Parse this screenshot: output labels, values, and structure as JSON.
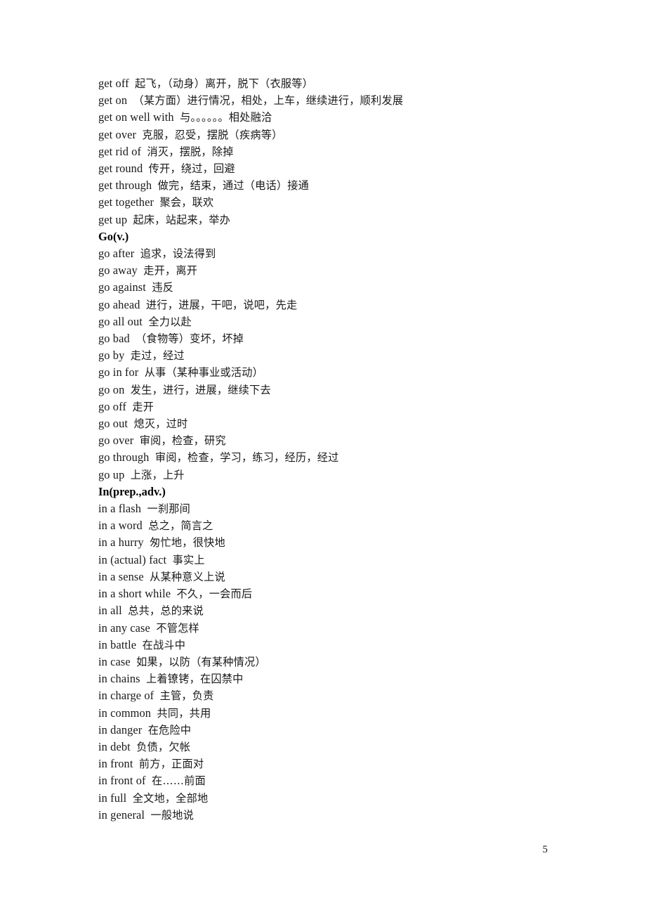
{
  "document": {
    "page_number": "5",
    "lines": [
      {
        "type": "entry",
        "term": "get off",
        "gloss": "起飞，（动身）离开，脱下（衣服等）"
      },
      {
        "type": "entry",
        "term": "get on",
        "gloss": "（某方面）进行情况，相处，上车，继续进行，顺利发展"
      },
      {
        "type": "entry",
        "term": "get on well with",
        "gloss": "与。。。。。。相处融洽"
      },
      {
        "type": "entry",
        "term": "get over",
        "gloss": "克服，忍受，摆脱（疾病等）"
      },
      {
        "type": "entry",
        "term": "get rid of",
        "gloss": "消灭，摆脱，除掉"
      },
      {
        "type": "entry",
        "term": "get round",
        "gloss": "传开，绕过，回避"
      },
      {
        "type": "entry",
        "term": "get through",
        "gloss": "做完，结束，通过（电话）接通"
      },
      {
        "type": "entry",
        "term": "get together",
        "gloss": "聚会，联欢"
      },
      {
        "type": "entry",
        "term": "get up",
        "gloss": "起床，站起来，举办"
      },
      {
        "type": "heading",
        "text": "Go(v.)"
      },
      {
        "type": "entry",
        "term": "go after",
        "gloss": "追求，设法得到"
      },
      {
        "type": "entry",
        "term": "go away",
        "gloss": "走开，离开"
      },
      {
        "type": "entry",
        "term": "go against",
        "gloss": "违反"
      },
      {
        "type": "entry",
        "term": "go ahead",
        "gloss": "进行，进展，干吧，说吧，先走"
      },
      {
        "type": "entry",
        "term": "go all out",
        "gloss": "全力以赴"
      },
      {
        "type": "entry",
        "term": "go bad",
        "gloss": "（食物等）变坏，坏掉"
      },
      {
        "type": "entry",
        "term": "go by",
        "gloss": "走过，经过"
      },
      {
        "type": "entry",
        "term": "go in for",
        "gloss": "从事（某种事业或活动）"
      },
      {
        "type": "entry",
        "term": "go on",
        "gloss": "发生，进行，进展，继续下去"
      },
      {
        "type": "entry",
        "term": "go off",
        "gloss": "走开"
      },
      {
        "type": "entry",
        "term": "go out",
        "gloss": "熄灭，过时"
      },
      {
        "type": "entry",
        "term": "go over",
        "gloss": "审阅，检查，研究"
      },
      {
        "type": "entry",
        "term": "go through",
        "gloss": "审阅，检查，学习，练习，经历，经过"
      },
      {
        "type": "entry",
        "term": "go up",
        "gloss": "上涨，上升"
      },
      {
        "type": "heading",
        "text": "In(prep.,adv.)"
      },
      {
        "type": "entry",
        "term": "in a flash",
        "gloss": "一刹那间"
      },
      {
        "type": "entry",
        "term": "in a word",
        "gloss": "总之，简言之"
      },
      {
        "type": "entry",
        "term": "in a hurry",
        "gloss": "匆忙地，很快地"
      },
      {
        "type": "entry",
        "term": "in (actual) fact",
        "gloss": "事实上"
      },
      {
        "type": "entry",
        "term": "in a sense",
        "gloss": "从某种意义上说"
      },
      {
        "type": "entry",
        "term": "in a short while",
        "gloss": "不久，一会而后"
      },
      {
        "type": "entry",
        "term": "in all",
        "gloss": "总共，总的来说"
      },
      {
        "type": "entry",
        "term": "in any case",
        "gloss": "不管怎样"
      },
      {
        "type": "entry",
        "term": "in battle",
        "gloss": "在战斗中"
      },
      {
        "type": "entry",
        "term": "in case",
        "gloss": "如果，以防（有某种情况）"
      },
      {
        "type": "entry",
        "term": "in chains",
        "gloss": "上着镣铐，在囚禁中"
      },
      {
        "type": "entry",
        "term": "in charge of",
        "gloss": "主管，负责"
      },
      {
        "type": "entry",
        "term": "in common",
        "gloss": "共同，共用"
      },
      {
        "type": "entry",
        "term": "in danger",
        "gloss": "在危险中"
      },
      {
        "type": "entry",
        "term": "in debt",
        "gloss": "负债，欠帐"
      },
      {
        "type": "entry",
        "term": "in front",
        "gloss": "前方，正面对"
      },
      {
        "type": "entry",
        "term": "in front of",
        "gloss": "在……前面"
      },
      {
        "type": "entry",
        "term": "in full",
        "gloss": "全文地，全部地"
      },
      {
        "type": "entry",
        "term": "in general",
        "gloss": "一般地说"
      }
    ]
  }
}
